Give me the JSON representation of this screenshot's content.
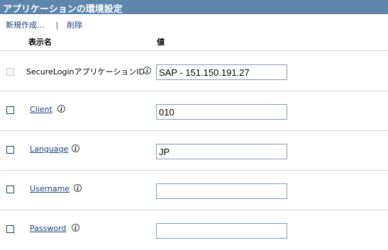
{
  "title": "アプリケーションの環境設定",
  "toolbar": {
    "new_label": "新規作成...",
    "separator": "|",
    "delete_label": "削除"
  },
  "columns": {
    "name": "表示名",
    "value": "値"
  },
  "rows": [
    {
      "name": "SecureLoginアプリケーションID",
      "value": "SAP - 151.150.191.27",
      "editable": false
    },
    {
      "name": "Client",
      "value": "010",
      "editable": true
    },
    {
      "name": "Language",
      "value": "JP",
      "editable": true
    },
    {
      "name": "Username",
      "value": "",
      "editable": true
    },
    {
      "name": "Password",
      "value": "",
      "editable": true
    }
  ],
  "info_icon_glyph": "i",
  "icons": {
    "info": "info-icon"
  },
  "colors": {
    "title_bar": "#5e86ad",
    "link": "#1c3f7a",
    "input_border": "#7f9db9"
  }
}
